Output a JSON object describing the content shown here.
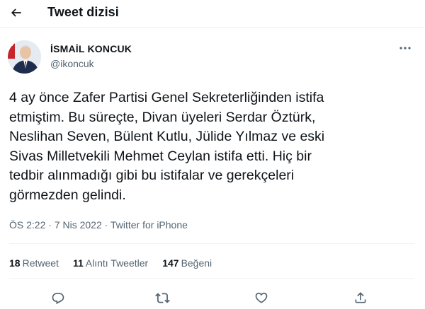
{
  "header": {
    "title": "Tweet dizisi",
    "back_icon": "arrow-left-icon"
  },
  "tweet": {
    "author": {
      "name": "İSMAİL KONCUK",
      "handle": "@ikoncuk",
      "avatar": "profile-photo"
    },
    "text_lines": [
      "4 ay önce Zafer Partisi Genel Sekreterliğinden istifa",
      "etmiştim. Bu süreçte, Divan üyeleri Serdar Öztürk,",
      "Neslihan Seven, Bülent Kutlu, Jülide Yılmaz ve eski",
      "Sivas Milletvekili Mehmet Ceylan istifa etti. Hiç bir",
      "tedbir alınmadığı gibi bu istifalar ve gerekçeleri",
      "görmezden gelindi."
    ],
    "meta": {
      "time": "ÖS 2:22",
      "date": "7 Nis 2022",
      "separator": "·",
      "source": "Twitter for iPhone"
    },
    "stats": {
      "retweets_count": "18",
      "retweets_label": "Retweet",
      "quotes_count": "11",
      "quotes_label": "Alıntı Tweetler",
      "likes_count": "147",
      "likes_label": "Beğeni"
    },
    "actions": [
      "reply-icon",
      "retweet-icon",
      "like-icon",
      "share-icon"
    ]
  },
  "colors": {
    "text_primary": "#0f1419",
    "text_secondary": "#536471",
    "divider": "#eff3f4",
    "background": "#ffffff"
  }
}
